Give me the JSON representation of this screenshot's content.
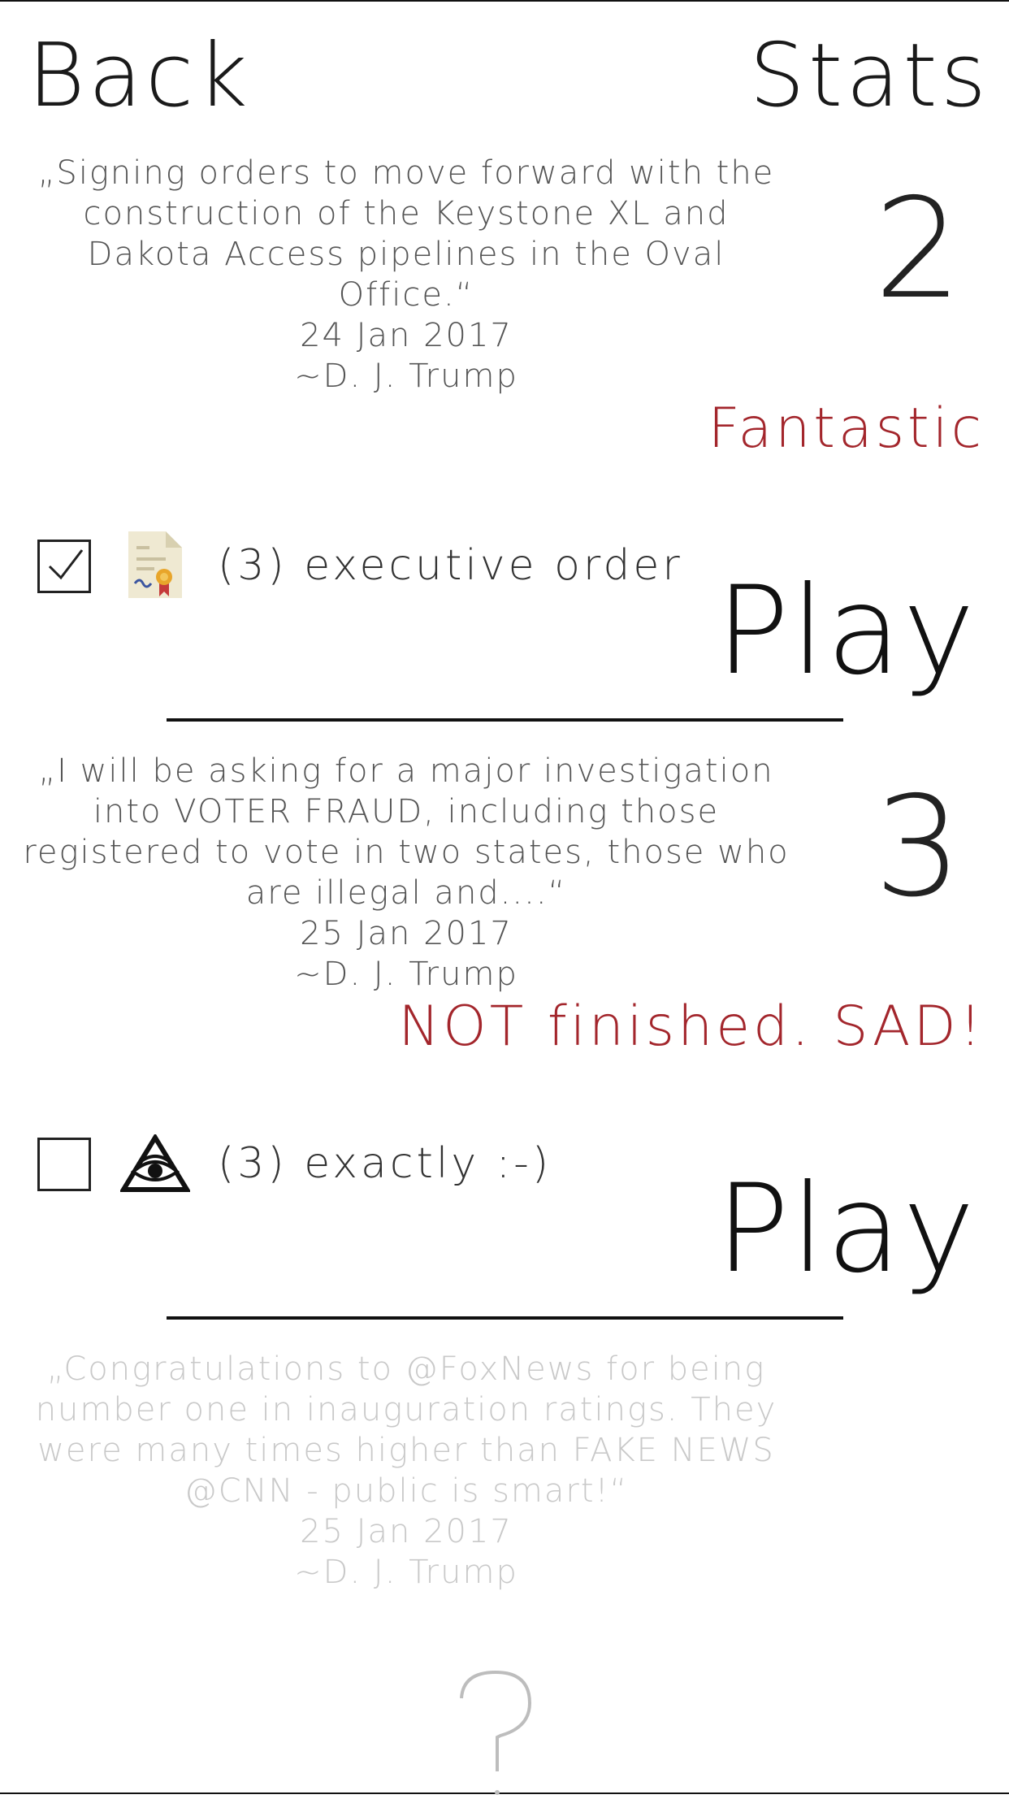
{
  "nav": {
    "back_label": "Back",
    "stats_label": "Stats"
  },
  "levels": [
    {
      "quote": "„Signing orders to move forward with the construction of the Keystone XL and Dakota Access pipelines in the Oval Office.“",
      "date": "24 Jan 2017",
      "author": "~D. J. Trump",
      "number": "2",
      "status": "Fantastic",
      "checked": true,
      "icon": "certificate-document-icon",
      "item_label": "(3) executive order",
      "play_label": "Play"
    },
    {
      "quote": "„I will be asking for a major investigation into VOTER FRAUD, including those registered to vote in two states, those who are illegal and....“",
      "date": "25 Jan 2017",
      "author": "~D. J. Trump",
      "number": "3",
      "status": "NOT finished. SAD!",
      "checked": false,
      "icon": "eye-pyramid-icon",
      "item_label": "(3) exactly :-)",
      "play_label": "Play"
    },
    {
      "quote": "„Congratulations to @FoxNews for being number one in inauguration ratings. They were many times higher than FAKE NEWS @CNN - public is smart!“",
      "date": "25 Jan 2017",
      "author": "~D. J. Trump",
      "locked": true
    }
  ],
  "colors": {
    "status_red": "#a3262c",
    "faded_text": "#c9c9c9"
  }
}
